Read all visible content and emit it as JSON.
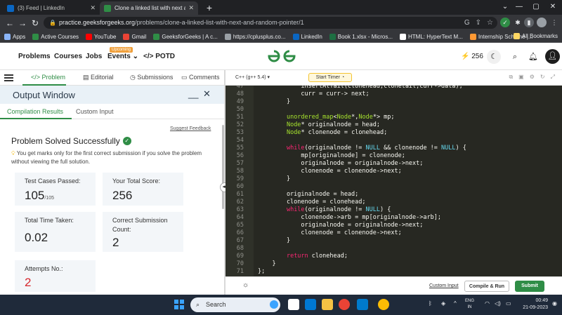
{
  "browser": {
    "tabs": [
      {
        "label": "(3) Feed | LinkedIn"
      },
      {
        "label": "Clone a linked list with next and r"
      }
    ],
    "url_host": "practice.geeksforgeeks.org",
    "url_path": "/problems/clone-a-linked-list-with-next-and-random-pointer/1",
    "bookmarks": [
      "Apps",
      "Active Courses",
      "YouTube",
      "Gmail",
      "GeeksforGeeks | A c...",
      "https://cplusplus.co...",
      "LinkedIn",
      "Book 1.xlsx - Micros...",
      "HTML: HyperText M...",
      "Internship Scheme |..."
    ],
    "all_bookmarks": "All Bookmarks"
  },
  "gfg": {
    "nav": [
      "Problems",
      "Courses",
      "Jobs",
      "Events",
      "POTD"
    ],
    "upcoming_badge": "Upcoming",
    "logo_text": "GG",
    "streak": "256",
    "brand_color": "#2f8d46"
  },
  "left_tabs": {
    "problem": "Problem",
    "editorial": "Editorial",
    "submissions": "Submissions",
    "comments": "Comments"
  },
  "output": {
    "title": "Output Window",
    "minimize": "__",
    "close": "✕",
    "tab_compilation": "Compilation Results",
    "tab_custom": "Custom Input",
    "suggest": "Suggest Feedback",
    "status": "Problem Solved Successfully",
    "note": "You get marks only for the first correct submission if you solve the problem without viewing the full solution.",
    "cards": {
      "tests_label": "Test Cases Passed:",
      "tests_value": "105",
      "tests_total": "/105",
      "score_label": "Your Total Score:",
      "score_value": "256",
      "time_label": "Total Time Taken:",
      "time_value": "0.02",
      "correct_label": "Correct Submission Count:",
      "correct_value": "2",
      "attempts_label": "Attempts No.:",
      "attempts_value": "2"
    }
  },
  "editor": {
    "language": "C++ (g++ 5.4)",
    "timer": "Start Timer",
    "lines": [
      {
        "n": "47",
        "t": "            insertAtTail(clonehead,clonetail,curr->data);"
      },
      {
        "n": "48",
        "t": "            curr = curr-> next;"
      },
      {
        "n": "49",
        "t": "        }"
      },
      {
        "n": "50",
        "t": ""
      },
      {
        "n": "51",
        "t": "        unordered_map<Node*,Node*> mp;"
      },
      {
        "n": "52",
        "t": "        Node* originalnode = head;"
      },
      {
        "n": "53",
        "t": "        Node* clonenode = clonehead;"
      },
      {
        "n": "54",
        "t": ""
      },
      {
        "n": "55",
        "t": "        while(originalnode != NULL && clonenode != NULL) {"
      },
      {
        "n": "56",
        "t": "            mp[originalnode] = clonenode;"
      },
      {
        "n": "57",
        "t": "            originalnode = originalnode->next;"
      },
      {
        "n": "58",
        "t": "            clonenode = clonenode->next;"
      },
      {
        "n": "59",
        "t": "        }"
      },
      {
        "n": "60",
        "t": ""
      },
      {
        "n": "61",
        "t": "        originalnode = head;"
      },
      {
        "n": "62",
        "t": "        clonenode = clonehead;"
      },
      {
        "n": "63",
        "t": "        while(originalnode != NULL) {"
      },
      {
        "n": "64",
        "t": "            clonenode->arb = mp[originalnode->arb];"
      },
      {
        "n": "65",
        "t": "            originalnode = originalnode->next;"
      },
      {
        "n": "66",
        "t": "            clonenode = clonenode->next;"
      },
      {
        "n": "67",
        "t": "        }"
      },
      {
        "n": "68",
        "t": ""
      },
      {
        "n": "69",
        "t": "        return clonehead;"
      },
      {
        "n": "70",
        "t": "    }"
      },
      {
        "n": "71",
        "t": "};"
      }
    ],
    "custom_input": "Custom Input",
    "compile_run": "Compile & Run",
    "submit": "Submit"
  },
  "taskbar": {
    "search": "Search",
    "lang_top": "ENG",
    "lang_bottom": "IN",
    "time": "00:49",
    "date": "21-09-2023"
  }
}
